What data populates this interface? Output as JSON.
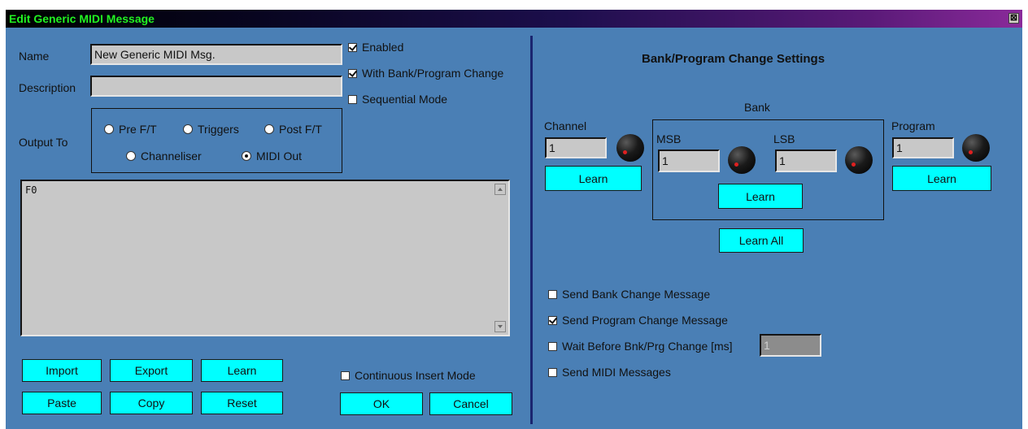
{
  "window": {
    "title": "Edit Generic MIDI Message",
    "close_glyph": "⊠"
  },
  "left": {
    "name_label": "Name",
    "name_value": "New Generic MIDI Msg.",
    "description_label": "Description",
    "description_value": "",
    "enabled_label": "Enabled",
    "enabled_checked": true,
    "bank_prog_label": "With Bank/Program Change",
    "bank_prog_checked": true,
    "sequential_label": "Sequential Mode",
    "sequential_checked": false,
    "output_label": "Output To",
    "output_options": [
      "Pre F/T",
      "Triggers",
      "Post F/T",
      "Channeliser",
      "MIDI Out"
    ],
    "output_selected": "MIDI Out",
    "message_text": "F0",
    "continuous_label": "Continuous Insert Mode",
    "continuous_checked": false,
    "buttons": {
      "import": "Import",
      "export": "Export",
      "learn": "Learn",
      "paste": "Paste",
      "copy": "Copy",
      "reset": "Reset",
      "ok": "OK",
      "cancel": "Cancel"
    }
  },
  "right": {
    "heading": "Bank/Program Change Settings",
    "bank_label": "Bank",
    "channel_label": "Channel",
    "channel_value": "1",
    "channel_learn": "Learn",
    "msb_label": "MSB",
    "msb_value": "1",
    "lsb_label": "LSB",
    "lsb_value": "1",
    "bank_learn": "Learn",
    "program_label": "Program",
    "program_value": "1",
    "program_learn": "Learn",
    "learn_all": "Learn All",
    "send_bank_label": "Send Bank Change Message",
    "send_bank_checked": false,
    "send_program_label": "Send Program Change Message",
    "send_program_checked": true,
    "wait_label": "Wait Before Bnk/Prg Change [ms]",
    "wait_checked": false,
    "wait_value": "1",
    "send_midi_label": "Send MIDI Messages",
    "send_midi_checked": false
  },
  "colors": {
    "background": "#4a7fb5",
    "button": "#00ffff",
    "title_text": "#22f322",
    "divider": "#1a2570",
    "knob_indicator": "#e02020"
  }
}
